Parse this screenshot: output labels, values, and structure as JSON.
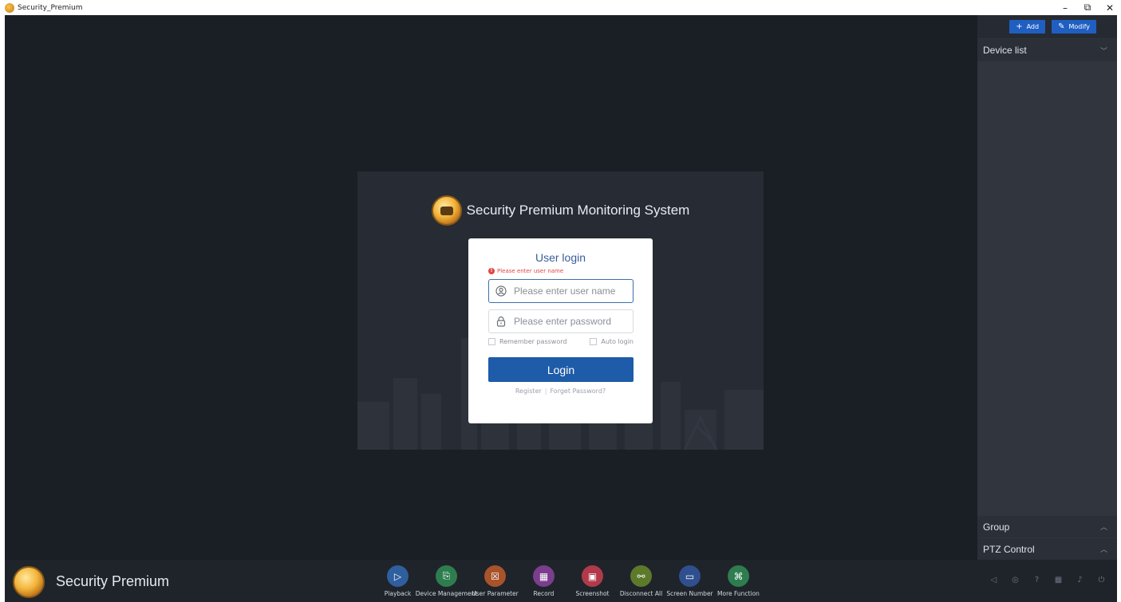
{
  "window": {
    "title": "Security_Premium",
    "controls": {
      "minimize": "–",
      "restore": "⧉",
      "close": "✕"
    }
  },
  "login": {
    "brand_title": "Security Premium Monitoring System",
    "card_title": "User login",
    "error_text": "Please enter user name",
    "username_placeholder": "Please enter user name",
    "password_placeholder": "Please enter password",
    "remember_label": "Remember password",
    "auto_label": "Auto login",
    "login_label": "Login",
    "register_label": "Register",
    "forgot_label": "Forget Password?",
    "separator": "|"
  },
  "sidebar": {
    "add_label": "Add",
    "modify_label": "Modify",
    "device_list": "Device list",
    "group": "Group",
    "ptz": "PTZ Control"
  },
  "bottom": {
    "brand": "Security Premium",
    "tools": [
      {
        "label": "Playback",
        "color": "#2f5f9e",
        "icon": "playback-icon"
      },
      {
        "label": "Device Management",
        "color": "#2e7d4f",
        "icon": "device-icon"
      },
      {
        "label": "User Parameter",
        "color": "#a8532a",
        "icon": "parameter-icon"
      },
      {
        "label": "Record",
        "color": "#7a3e8c",
        "icon": "record-icon"
      },
      {
        "label": "Screenshot",
        "color": "#b03a4a",
        "icon": "screenshot-icon"
      },
      {
        "label": "Disconnect All",
        "color": "#5c7a2a",
        "icon": "disconnect-icon"
      },
      {
        "label": "Screen Number",
        "color": "#2f4f8e",
        "icon": "screen-icon"
      },
      {
        "label": "More Function",
        "color": "#2e7d4f",
        "icon": "more-icon"
      }
    ]
  }
}
